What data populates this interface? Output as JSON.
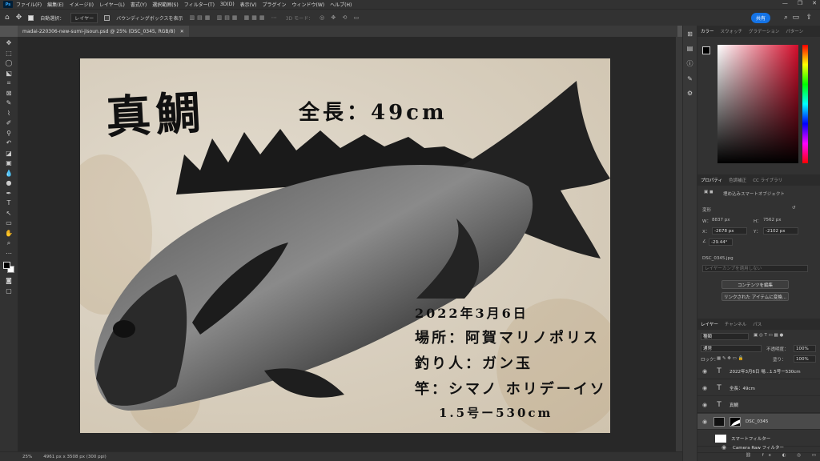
{
  "menu": {
    "items": [
      "ファイル(F)",
      "編集(E)",
      "イメージ(I)",
      "レイヤー(L)",
      "書式(Y)",
      "選択範囲(S)",
      "フィルター(T)",
      "3D(D)",
      "表示(V)",
      "プラグイン",
      "ウィンドウ(W)",
      "ヘルプ(H)"
    ]
  },
  "options": {
    "auto_select_label": "自動選択：",
    "layer_select": "レイヤー",
    "bbox_label": "バウンディングボックスを表示",
    "mode3d": "3D モード：",
    "share": "共有"
  },
  "document": {
    "tab_title": "madai-220306-new-sumi-jisoun.psd @ 25% (DSC_0345, RGB/8)"
  },
  "artwork": {
    "title": "真鯛",
    "length": "全長：49cm",
    "date": "2022年3月6日",
    "place": "場所：阿賀マリノポリス",
    "angler": "釣り人：ガン玉",
    "rod": "竿：シマノ ホリデーイソ",
    "rod2": "1.5号ー530cm"
  },
  "color_panel": {
    "tabs": [
      "カラー",
      "スウォッチ",
      "グラデーション",
      "パターン"
    ]
  },
  "props_panel": {
    "tabs": [
      "プロパティ",
      "色調補正",
      "CC ライブラリ"
    ],
    "type": "埋め込みスマートオブジェクト",
    "transform_label": "変形",
    "w_label": "W：",
    "w": "8837 px",
    "h_label": "H：",
    "h": "7562 px",
    "x_label": "X：",
    "x": "-2678 px",
    "y_label": "Y：",
    "y": "-2102 px",
    "angle": "-29.44°",
    "filename": "DSC_0345.jpg",
    "comp_placeholder": "レイヤーカンプを適用しない",
    "edit_btn": "コンテンツを編集",
    "convert_btn": "リンクされた アイテムに変換..."
  },
  "layers_panel": {
    "tabs": [
      "レイヤー",
      "チャンネル",
      "パス"
    ],
    "filter": "種類",
    "blend": "通常",
    "opacity_label": "不透明度：",
    "opacity": "100%",
    "lock_label": "ロック：",
    "fill_label": "塗り：",
    "fill": "100%",
    "layers": [
      {
        "name": "2022年3月6日 場...1.5号ー530cm"
      },
      {
        "name": "全長：49cm"
      },
      {
        "name": "真鯛"
      },
      {
        "name": "DSC_0345"
      },
      {
        "name": "スマートフィルター"
      },
      {
        "name": "Camera Raw フィルター"
      }
    ]
  },
  "status": {
    "zoom": "25%",
    "dims": "4961 px x 3508 px (300 ppi)"
  }
}
